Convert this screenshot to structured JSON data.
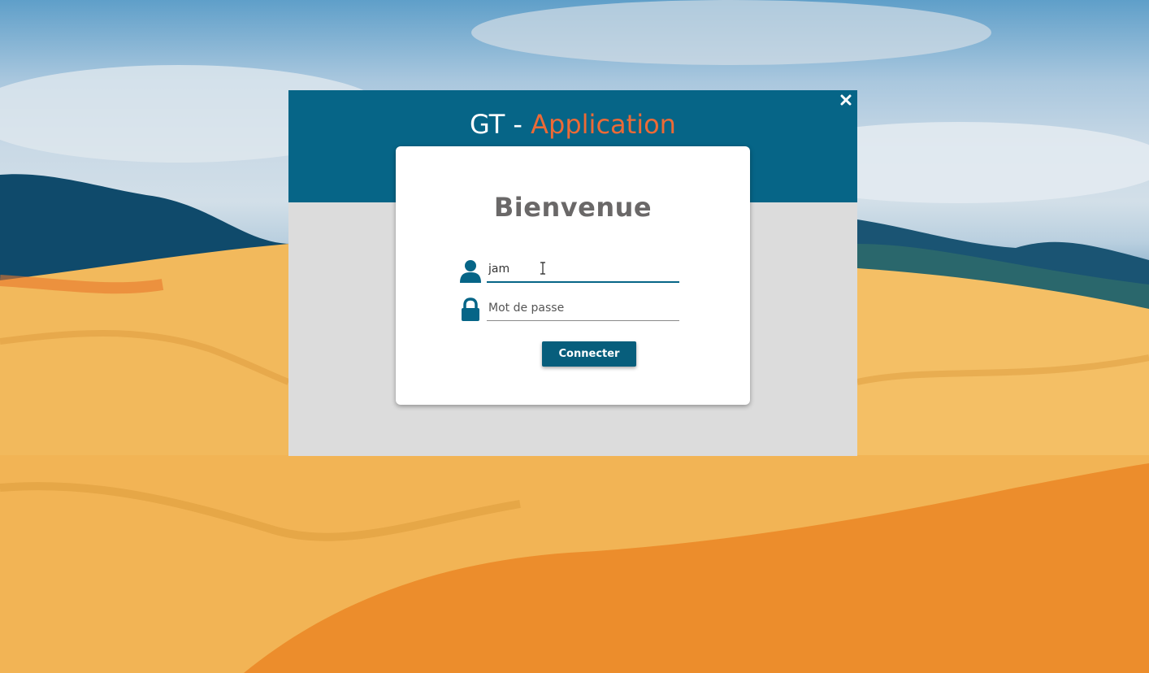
{
  "dialog": {
    "title_prefix": "GT - ",
    "title_accent": "Application",
    "close_icon": "close-icon"
  },
  "login": {
    "welcome": "Bienvenue",
    "username": {
      "value": "jam",
      "icon": "user-icon"
    },
    "password": {
      "value": "",
      "placeholder": "Mot de passe",
      "icon": "lock-icon"
    },
    "submit_label": "Connecter"
  },
  "colors": {
    "header": "#066587",
    "accent": "#ed6a36",
    "panel": "#dcdcdc",
    "button": "#075e7c",
    "welcome_text": "#6a6868"
  }
}
